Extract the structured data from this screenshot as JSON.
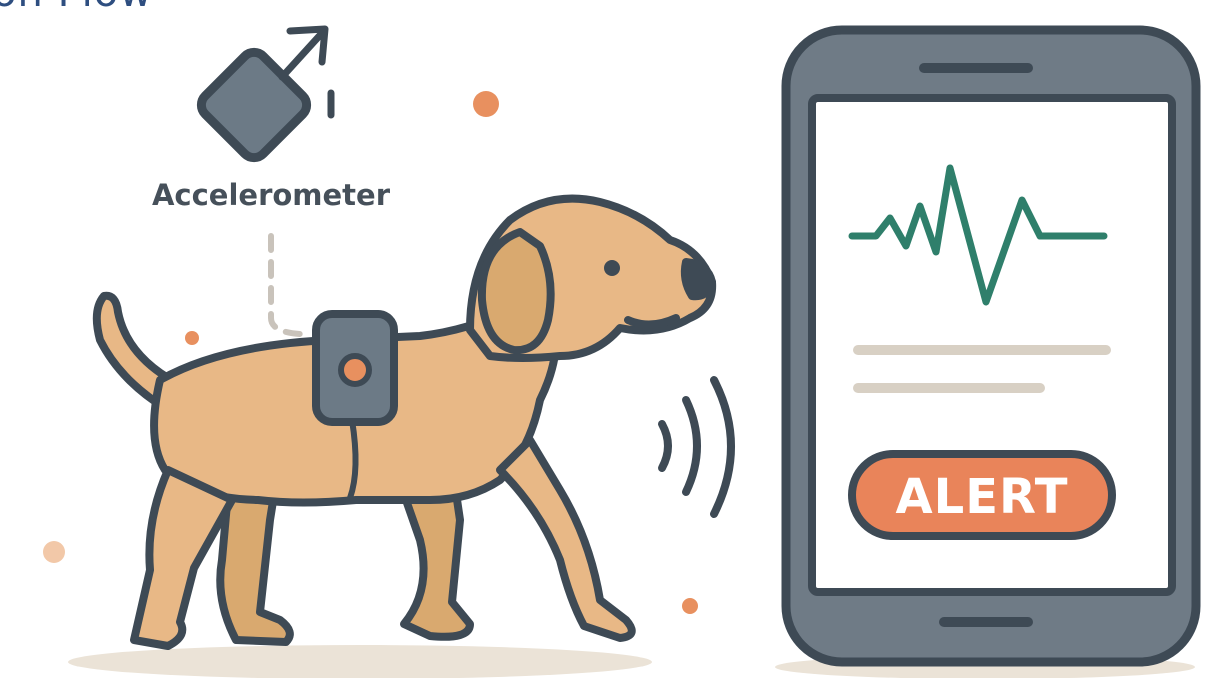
{
  "title": "ision Flow",
  "sensor": {
    "label": "Accelerometer"
  },
  "phone": {
    "alert_label": "ALERT"
  },
  "colors": {
    "outline": "#3e4a55",
    "dog_fur": "#e8b886",
    "dog_shadow": "#d9a96f",
    "sensor_gray": "#6c7a86",
    "accent_orange": "#e8905f",
    "heartbeat": "#2f7f6b",
    "phone_body": "#6f7b86",
    "screen": "#ffffff",
    "placeholder_line": "#d8d0c4",
    "alert_fill": "#e9845a",
    "title_blue": "#2e4e80",
    "ground": "#ebe3d7"
  },
  "icons": {
    "sensor_device": "accelerometer-icon",
    "movement": "motion-arrow-icon",
    "wireless": "wireless-signal-icon",
    "heartbeat": "heartbeat-icon"
  }
}
